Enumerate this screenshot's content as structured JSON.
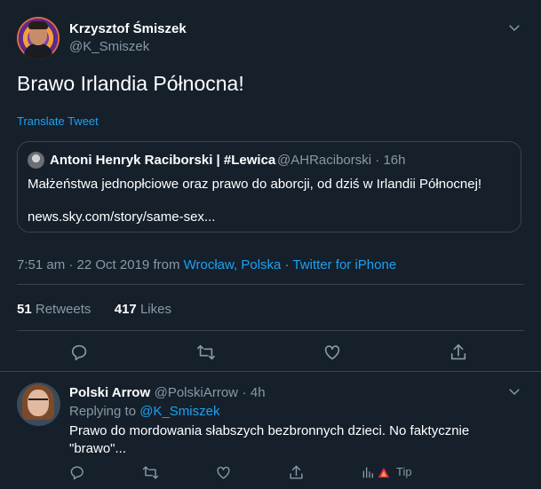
{
  "colors": {
    "background": "#15202b",
    "border": "#38444d",
    "muted": "#8899a6",
    "link": "#1da1f2",
    "text": "#ffffff"
  },
  "main_tweet": {
    "author_name": "Krzysztof Śmiszek",
    "author_handle": "@K_Smiszek",
    "text": "Brawo Irlandia Północna!",
    "translate_label": "Translate Tweet",
    "quote": {
      "author_name": "Antoni Henryk Raciborski | #Lewica",
      "author_handle": "@AHRaciborski",
      "separator": "·",
      "time": "16h",
      "text": "Małżeństwa jednopłciowe oraz prawo do aborcji, od dziś w Irlandii Północnej!",
      "link": "news.sky.com/story/same-sex..."
    },
    "timestamp": "7:51 am · 22 Oct 2019",
    "from_label": "from",
    "location": "Wrocław, Polska",
    "source_separator": "·",
    "source": "Twitter for iPhone",
    "retweets_count": "51",
    "retweets_label": "Retweets",
    "likes_count": "417",
    "likes_label": "Likes",
    "actions": [
      "reply-icon",
      "retweet-icon",
      "like-icon",
      "share-icon"
    ]
  },
  "reply_tweet": {
    "author_name": "Polski Arrow",
    "author_handle": "@PolskiArrow",
    "separator": "·",
    "time": "4h",
    "replying_to_label": "Replying to",
    "replying_to_handle": "@K_Smiszek",
    "text": "Prawo do mordowania słabszych bezbronnych dzieci. No faktycznie \"brawo\"...",
    "tip_label": "Tip",
    "actions": [
      "reply-icon",
      "retweet-icon",
      "like-icon",
      "share-icon",
      "analytics-icon",
      "tip-icon"
    ]
  }
}
